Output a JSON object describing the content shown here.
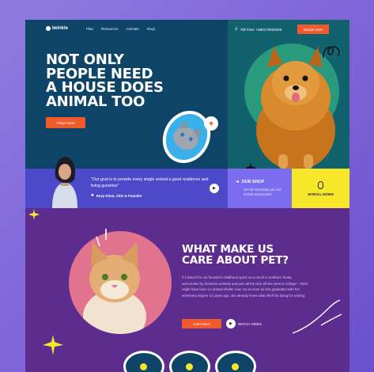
{
  "brand": {
    "name": "Iwinkle"
  },
  "nav": {
    "links": [
      "Plan",
      "Resources",
      "Animals",
      "Shop"
    ]
  },
  "contact": {
    "phone": "Toll Free: +880170000000"
  },
  "cta": {
    "donate": "Donate Now!",
    "adopt": "Adopt Now!"
  },
  "hero": {
    "headline": [
      "NOT ONLY",
      "PEOPLE NEED",
      "A HOUSE DOES",
      "ANIMAL TOO"
    ]
  },
  "quote": {
    "text": "\"Our goal is to provide every single animal a good residence and living gurantes\"",
    "author": "Rozy Khan, CEO & Founder"
  },
  "shop": {
    "title": "OUR SHOP",
    "subtitle": "Get all necessary pet and animal accessories"
  },
  "scroll": {
    "label": "SCROLL DOWN"
  },
  "care": {
    "title": [
      "WHAT MAKE US",
      "CARE ABOUT PET?"
    ],
    "body": "If it wasn't for our founder's childhood spent on a ranch in northern Texas, surrounded by domestic animals and pets all the time till she went to college – there might have been no animal shelter now. So as soon as she graduated with her veterinary degree 12 years ago, she already knew what she'll be doing for a living.",
    "learn": "Learn More",
    "watch": "WATCH VIDEO"
  },
  "colors": {
    "accent": "#f15a2b",
    "navy": "#0e4468",
    "teal": "#11626d",
    "purple": "#5c2d8e",
    "yellow": "#f7e72a",
    "violet": "#7b6cf0"
  }
}
